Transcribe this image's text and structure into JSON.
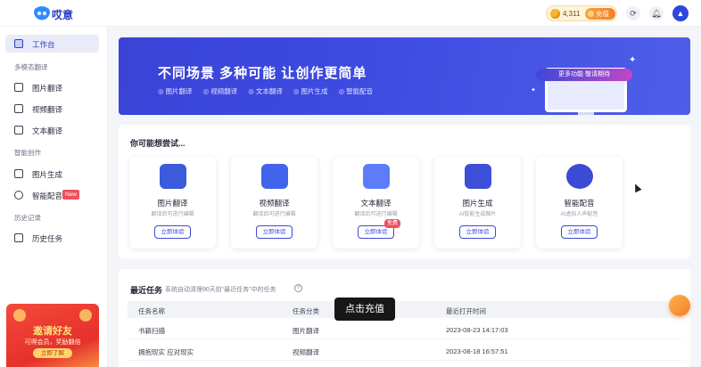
{
  "app": {
    "logo_text": "哎意"
  },
  "header": {
    "coins": "4,311",
    "recharge_label": "充值",
    "icons": [
      "refresh-icon",
      "bell-icon",
      "user-avatar"
    ]
  },
  "sidebar": {
    "workbench": "工作台",
    "section_translate": "多模态翻译",
    "items_translate": [
      {
        "label": "图片翻译",
        "icon": "image-icon"
      },
      {
        "label": "视频翻译",
        "icon": "video-icon"
      },
      {
        "label": "文本翻译",
        "icon": "document-icon"
      }
    ],
    "section_create": "智能创作",
    "items_create": [
      {
        "label": "图片生成",
        "icon": "image-generate-icon"
      },
      {
        "label": "智能配音",
        "icon": "voice-icon",
        "badge": "New"
      }
    ],
    "section_history": "历史记录",
    "items_history": [
      {
        "label": "历史任务",
        "icon": "history-icon"
      }
    ],
    "promo": {
      "title": "邀请好友",
      "subtitle": "可得会员，奖励翻倍",
      "button": "立即了解"
    }
  },
  "banner": {
    "title": "不同场景 多种可能 让创作更简单",
    "tags": [
      "图片翻译",
      "视频翻译",
      "文本翻译",
      "图片生成",
      "智能配音"
    ],
    "pill": "更多功能 敬请期待"
  },
  "try_section": {
    "title": "你可能想尝试...",
    "features": [
      {
        "name": "图片翻译",
        "desc": "翻译后可进行编辑",
        "button": "立即体验",
        "color": "#3b5bdb"
      },
      {
        "name": "视频翻译",
        "desc": "翻译后可进行编辑",
        "button": "立即体验",
        "color": "#4263eb"
      },
      {
        "name": "文本翻译",
        "desc": "翻译后可进行编辑",
        "button": "立即体验",
        "color": "#5c7cfa",
        "badge": "免费"
      },
      {
        "name": "图片生成",
        "desc": "AI智能生成图片",
        "button": "立即体验",
        "color": "#3d4fd8"
      },
      {
        "name": "智能配音",
        "desc": "AI虚拟人声配音",
        "button": "立即体验",
        "color": "#3b4bd4"
      }
    ]
  },
  "tasks": {
    "title": "最近任务",
    "note": "系统自动清理90天前“最近任务”中的任务",
    "columns": [
      "任务名称",
      "任务分类",
      "最近打开时间"
    ],
    "rows": [
      [
        "书籍扫描",
        "图片翻译",
        "2023-08-23 14:17:03"
      ],
      [
        "拥抱现实 应对现实",
        "视频翻译",
        "2023-08-18 16:57:51"
      ]
    ]
  },
  "tooltip": "点击充值"
}
